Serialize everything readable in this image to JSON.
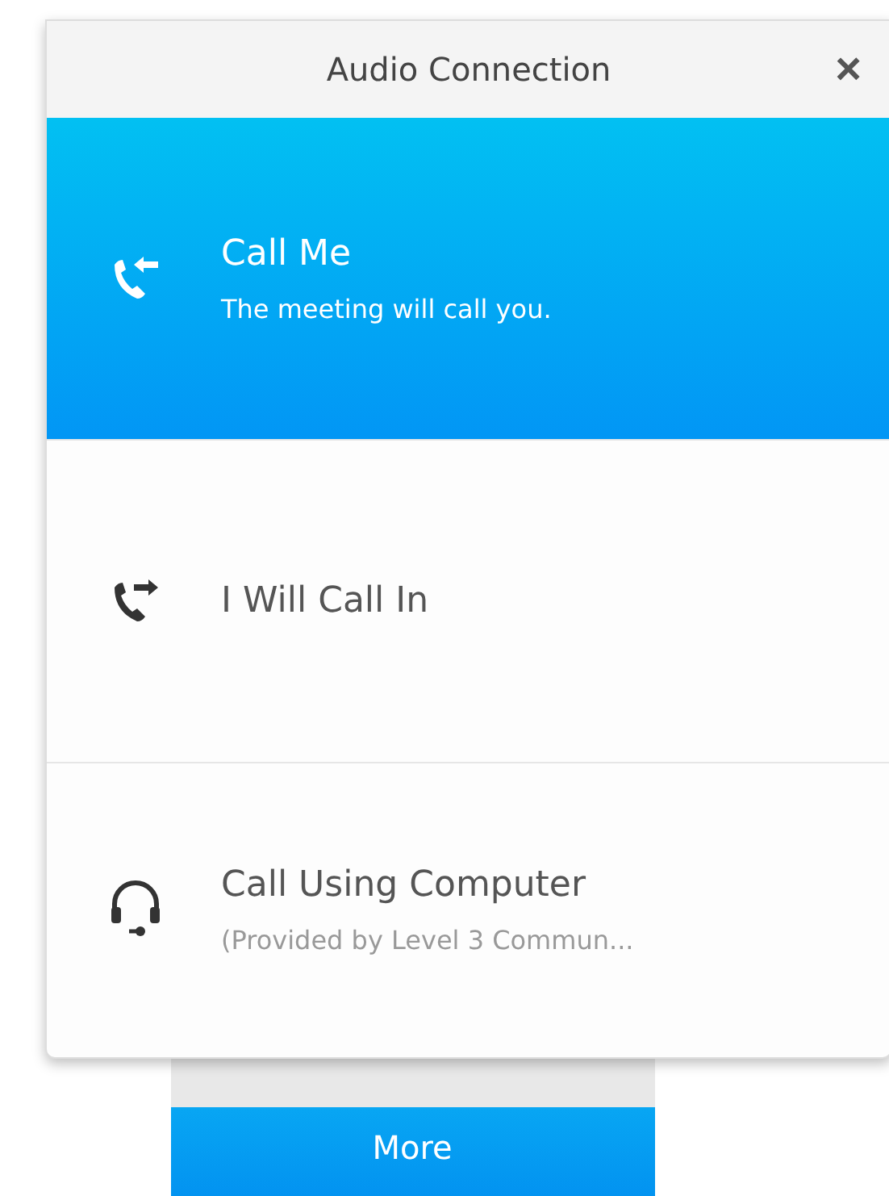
{
  "dialog": {
    "title": "Audio Connection",
    "close": "×"
  },
  "options": [
    {
      "kind": "call-me",
      "title": "Call Me",
      "subtitle": "The meeting will call you.",
      "selected": true
    },
    {
      "kind": "call-in",
      "title": "I Will Call In",
      "selected": false
    },
    {
      "kind": "computer",
      "title": "Call Using Computer",
      "subtitle": "(Provided by Level 3 Commun...",
      "selected": false
    }
  ],
  "more_button": "More"
}
